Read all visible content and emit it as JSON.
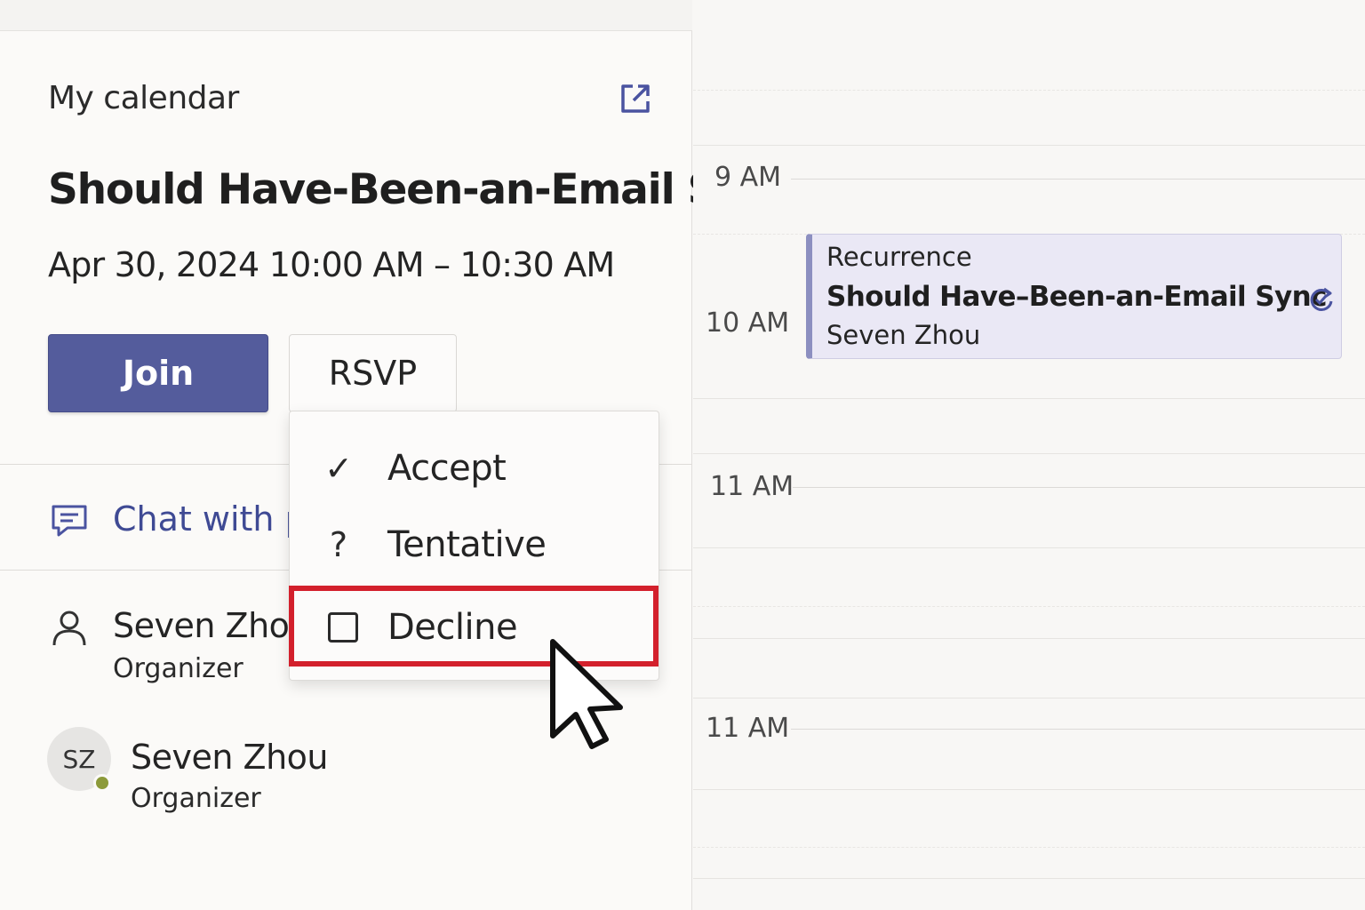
{
  "panel": {
    "calendar_label": "My calendar",
    "meeting_title": "Should Have-Been-an-Email Sync",
    "meeting_time": "Apr 30, 2024 10:00 AM – 10:30 AM",
    "join_label": "Join",
    "rsvp_label": "RSVP",
    "chat_label": "Chat with p",
    "attendees": [
      {
        "name": "Seven Zhou",
        "role": "Organizer"
      },
      {
        "name": "Seven Zhou",
        "role": "Organizer",
        "initials": "SZ"
      }
    ]
  },
  "rsvp_menu": {
    "items": [
      {
        "glyph": "✓",
        "label": "Accept"
      },
      {
        "glyph": "?",
        "label": "Tentative"
      },
      {
        "glyph": "",
        "label": "Decline"
      }
    ]
  },
  "calendar": {
    "time_labels": [
      "9 AM",
      "10 AM",
      "11 AM",
      "11 AM"
    ],
    "event": {
      "recurrence": "Recurrence",
      "title": "Should Have–Been-an-Email Sync",
      "organizer": "Seven Zhou"
    }
  },
  "colors": {
    "join_button": "#545c9c",
    "highlight": "#d3202c",
    "event_background": "#eae8f5",
    "presence": "#8c9a3a",
    "link": "#3f4a94"
  },
  "icons": [
    "popout-icon",
    "chat-icon",
    "person-icon",
    "checkmark-icon",
    "question-icon",
    "checkbox-icon",
    "sync-icon",
    "mouse-cursor-icon"
  ]
}
